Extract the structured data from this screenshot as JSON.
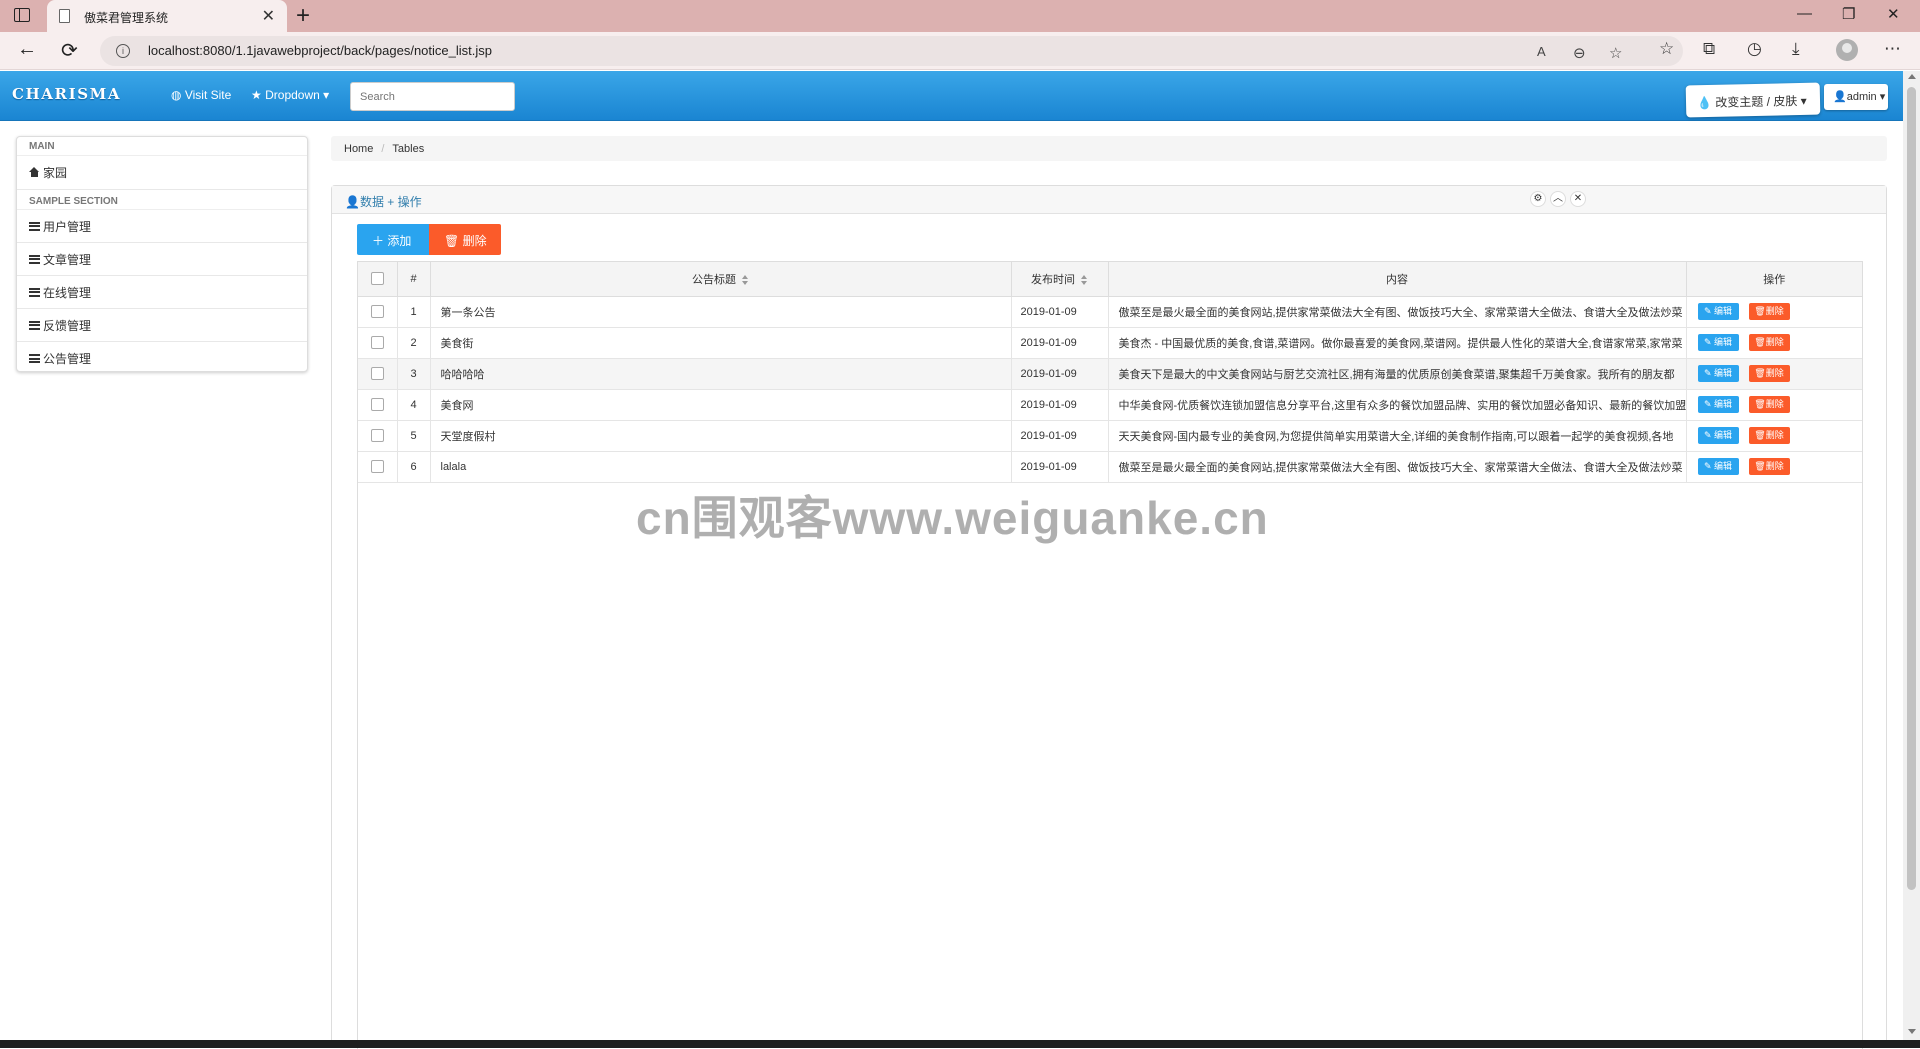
{
  "browser": {
    "tab_title": "傲菜君管理系统",
    "tab_close": "✕",
    "new_tab": "+",
    "url": "localhost:8080/1.1javawebproject/back/pages/notice_list.jsp",
    "win_min": "—",
    "win_restore": "❐",
    "win_close": "✕",
    "back": "←",
    "reload": "⟳",
    "icon_read_aloud": "A",
    "icon_zoom": "⊖",
    "icon_favorite_add": "☆",
    "icon_favorites": "☆",
    "icon_collections": "⧉",
    "icon_history": "◷",
    "icon_downloads": "⤓",
    "icon_more": "⋯"
  },
  "navbar": {
    "brand": "CHARISMA",
    "visit_site": "Visit Site",
    "dropdown": "Dropdown ▾",
    "search_placeholder": "Search",
    "theme_button": "改变主题 / 皮肤 ▾",
    "admin_button": "admin ▾"
  },
  "sidebar": {
    "header_main": "MAIN",
    "home": "家园",
    "header_sample": "SAMPLE SECTION",
    "items": [
      {
        "label": "用户管理"
      },
      {
        "label": "文章管理"
      },
      {
        "label": "在线管理"
      },
      {
        "label": "反馈管理"
      },
      {
        "label": "公告管理"
      }
    ]
  },
  "breadcrumb": {
    "home": "Home",
    "current": "Tables"
  },
  "panel": {
    "title": "数据 + 操作",
    "add_button": "添加",
    "delete_button": "删除",
    "gear": "⚙",
    "collapse": "︿",
    "close": "✕"
  },
  "table": {
    "headers": {
      "index": "#",
      "title": "公告标题",
      "date": "发布时间",
      "content": "内容",
      "actions": "操作"
    },
    "edit_label": "编辑",
    "delete_label": "删除",
    "rows": [
      {
        "id": "1",
        "title": "第一条公告",
        "date": "2019-01-09",
        "content": "傲菜至是最火最全面的美食网站,提供家常菜做法大全有图、做饭技巧大全、家常菜谱大全做法、食谱大全及做法炒菜"
      },
      {
        "id": "2",
        "title": "美食街",
        "date": "2019-01-09",
        "content": "美食杰 - 中国最优质的美食,食谱,菜谱网。做你最喜爱的美食网,菜谱网。提供最人性化的菜谱大全,食谱家常菜,家常菜"
      },
      {
        "id": "3",
        "title": "哈哈哈哈",
        "date": "2019-01-09",
        "content": "美食天下是最大的中文美食网站与厨艺交流社区,拥有海量的优质原创美食菜谱,聚集超千万美食家。我所有的朋友都"
      },
      {
        "id": "4",
        "title": "美食网",
        "date": "2019-01-09",
        "content": "中华美食网-优质餐饮连锁加盟信息分享平台,这里有众多的餐饮加盟品牌、实用的餐饮加盟必备知识、最新的餐饮加盟"
      },
      {
        "id": "5",
        "title": "天堂度假村",
        "date": "2019-01-09",
        "content": "天天美食网-国内最专业的美食网,为您提供简单实用菜谱大全,详细的美食制作指南,可以跟着一起学的美食视频,各地"
      },
      {
        "id": "6",
        "title": "lalala",
        "date": "2019-01-09",
        "content": "傲菜至是最火最全面的美食网站,提供家常菜做法大全有图、做饭技巧大全、家常菜谱大全做法、食谱大全及做法炒菜"
      }
    ]
  },
  "watermark": "cn围观客www.weiguanke.cn",
  "colors": {
    "navbar": "#2196e3",
    "add_button": "#2aa4ef",
    "delete_button": "#fb5b2a",
    "link": "#317eac"
  }
}
